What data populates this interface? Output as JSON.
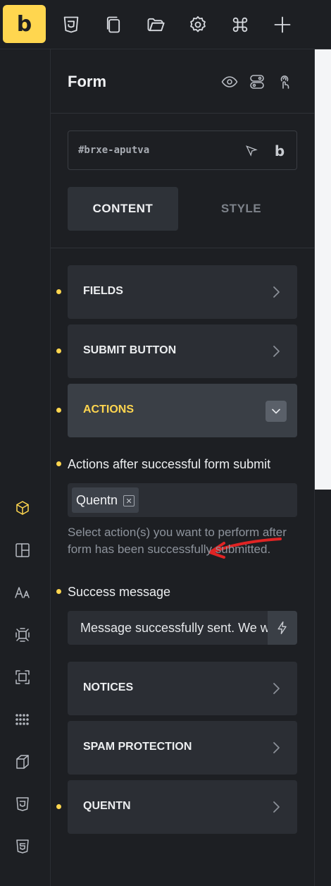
{
  "toolbar": {
    "logo": "b",
    "icons": [
      "css3-icon",
      "pages-icon",
      "folder-icon",
      "settings-icon",
      "command-icon",
      "add-icon"
    ]
  },
  "sidebar": {
    "icons": [
      "elements-icon",
      "layout-icon",
      "typography-icon",
      "components-icon",
      "frame-icon",
      "grid-dots-icon",
      "box-icon",
      "css3-icon",
      "html5-icon"
    ],
    "active": "elements-icon"
  },
  "panel": {
    "title": "Form",
    "element_id": "#brxe-aputva",
    "id_logo": "b",
    "tabs": [
      {
        "label": "CONTENT",
        "active": true
      },
      {
        "label": "STYLE",
        "active": false
      }
    ],
    "groups": {
      "fields": "FIELDS",
      "submit_button": "SUBMIT BUTTON",
      "actions": "ACTIONS",
      "notices": "NOTICES",
      "spam_protection": "SPAM PROTECTION",
      "quentn": "QUENTN"
    },
    "actions_field": {
      "label": "Actions after successful form submit",
      "selected": [
        "Quentn"
      ],
      "remove_glyph": "✕",
      "help": "Select action(s) you want to perform after form has been successfully submitted."
    },
    "success_field": {
      "label": "Success message",
      "value": "Message successfully sent. We will get back to you as soon as possible."
    }
  },
  "colors": {
    "accent": "#ffd64f",
    "background": "#1d1f23",
    "control": "#2b2e34",
    "annotation_arrow": "#e02424"
  }
}
